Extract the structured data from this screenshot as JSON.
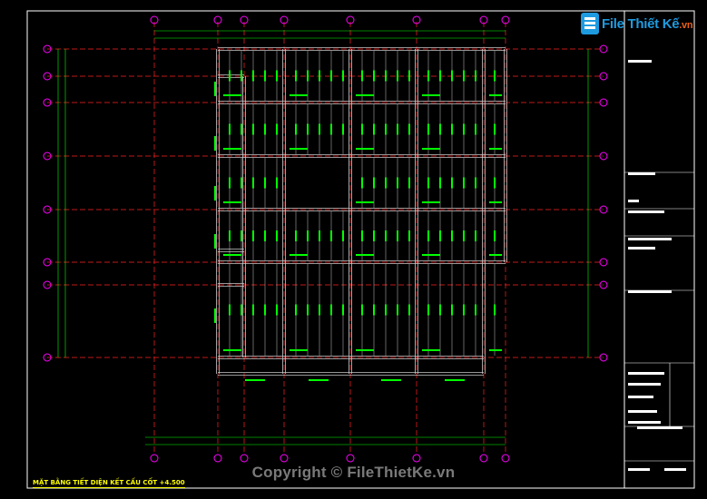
{
  "logo": {
    "brand": "File Thiết Kế",
    "domain": ".vn"
  },
  "watermark": "Copyright © FileThietKe.vn",
  "title": "MẶT BẰNG TIẾT DIỆN KẾT CẤU CỐT +4.500",
  "colors": {
    "background": "#000000",
    "border": "#ffffff",
    "axis_line": "#ff2020",
    "grid_bubble": "#ff00ff",
    "beam": "#c8c8c8",
    "beam_label": "#00ff00",
    "dimension": "#00ff00",
    "title": "#ffff00",
    "logo_blue": "#1e9be0",
    "logo_orange": "#e8611a"
  }
}
